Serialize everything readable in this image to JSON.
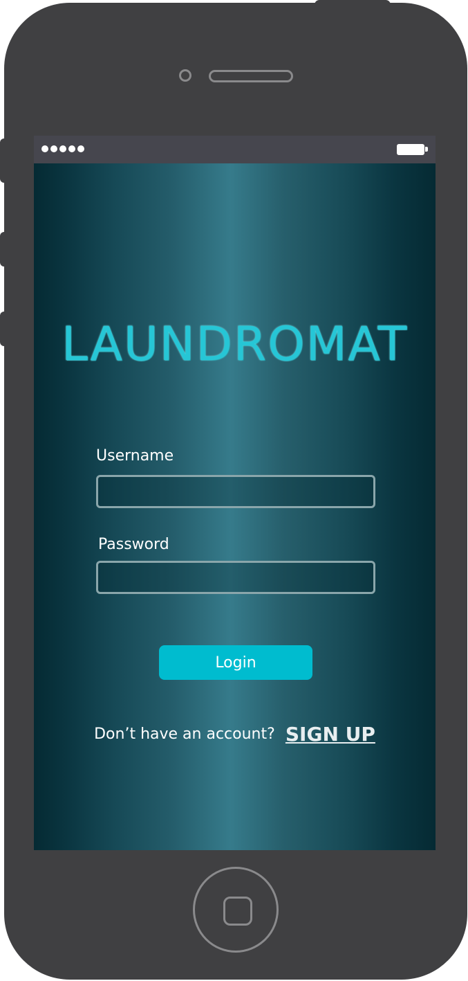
{
  "status_bar": {
    "signal_dots": 5,
    "battery_icon": "battery-full-icon"
  },
  "app": {
    "logo_text": "LAUNDROMAT"
  },
  "login_form": {
    "username_label": "Username",
    "username_value": "",
    "password_label": "Password",
    "password_value": "",
    "login_button_label": "Login"
  },
  "signup": {
    "prompt": "Don’t have an account?",
    "link_label": "SIGN UP"
  },
  "colors": {
    "accent": "#00bccf",
    "logo": "#26c6d6",
    "device_body": "#404042",
    "status_bar": "#46464e"
  }
}
